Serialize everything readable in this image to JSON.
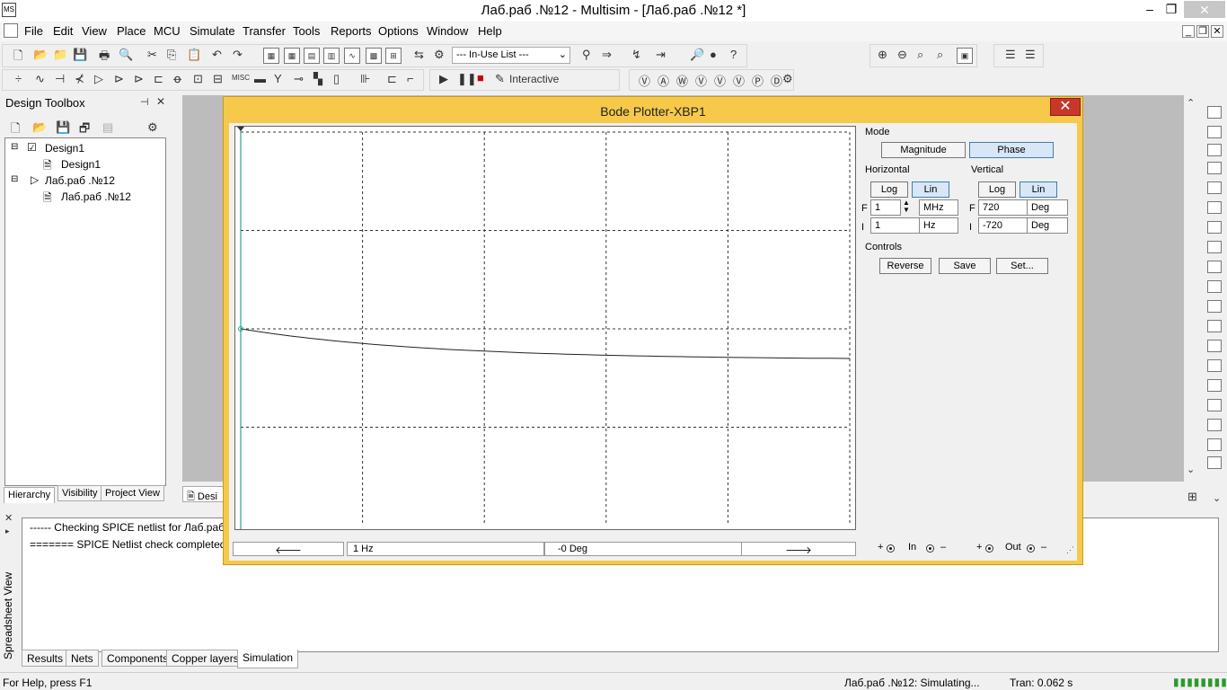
{
  "window": {
    "title": "Лаб.раб .№12 - Multisim - [Лаб.раб .№12 *]",
    "min": "–",
    "max": "❐",
    "close": "✕"
  },
  "menu": [
    "File",
    "Edit",
    "View",
    "Place",
    "MCU",
    "Simulate",
    "Transfer",
    "Tools",
    "Reports",
    "Options",
    "Window",
    "Help"
  ],
  "toolbar": {
    "inuse_list": "--- In-Use List ---",
    "interactive_label": "Interactive"
  },
  "design_toolbox": {
    "title": "Design Toolbox",
    "tree": [
      {
        "label": "Design1"
      },
      {
        "label": "Design1"
      },
      {
        "label": "Лаб.раб .№12"
      },
      {
        "label": "Лаб.раб .№12"
      }
    ],
    "tabs": [
      "Hierarchy",
      "Visibility",
      "Project View"
    ]
  },
  "workspace": {
    "tab_label": "Desi"
  },
  "bode": {
    "title": "Bode Plotter-XBP1",
    "mode_label": "Mode",
    "magnitude": "Magnitude",
    "phase": "Phase",
    "horizontal_label": "Horizontal",
    "vertical_label": "Vertical",
    "h_log": "Log",
    "h_lin": "Lin",
    "v_log": "Log",
    "v_lin": "Lin",
    "h_f_value": "1",
    "h_f_unit": "MHz",
    "h_i_value": "1",
    "h_i_unit": "Hz",
    "v_f_value": "720",
    "v_f_unit": "Deg",
    "v_i_value": "-720",
    "v_i_unit": "Deg",
    "f_letter": "F",
    "i_letter": "I",
    "controls_label": "Controls",
    "reverse": "Reverse",
    "save": "Save",
    "set": "Set...",
    "cursor_freq": "1 Hz",
    "cursor_value": "-0 Deg",
    "in_label": "In",
    "out_label": "Out",
    "plus": "+",
    "minus": "–",
    "left_arrow": "🡐",
    "right_arrow": "🡒"
  },
  "spreadsheet": {
    "side_label": "Spreadsheet View",
    "lines": [
      "------ Checking SPICE netlist for Лаб.раб",
      "======= SPICE Netlist check completed"
    ],
    "tabs": [
      "Results",
      "Nets",
      "Components",
      "Copper layers",
      "Simulation"
    ]
  },
  "status": {
    "help": "For Help, press F1",
    "sim": "Лаб.раб .№12: Simulating...",
    "tran": "Tran: 0.062 s"
  },
  "colors": {
    "bode_frame": "#f6c94a",
    "trace": "#222222",
    "cursor": "#2aa58a"
  }
}
